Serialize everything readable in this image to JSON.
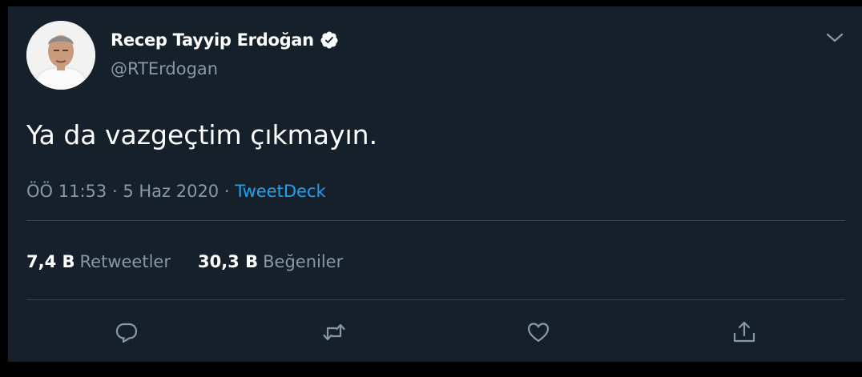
{
  "author": {
    "name": "Recep Tayyip Erdoğan",
    "handle": "@RTErdogan",
    "verified": true,
    "avatar_icon": "profile-photo"
  },
  "tweet": {
    "text": "Ya da vazgeçtim çıkmayın.",
    "time": "ÖÖ 11:53",
    "date": "5 Haz 2020",
    "separator": "·",
    "source": "TweetDeck"
  },
  "stats": {
    "retweets_count": "7,4 B",
    "retweets_label": "Retweetler",
    "likes_count": "30,3 B",
    "likes_label": "Beğeniler"
  },
  "actions": [
    "reply-icon",
    "retweet-icon",
    "like-icon",
    "share-icon"
  ],
  "colors": {
    "background": "#15202b",
    "text": "#ffffff",
    "muted": "#8899a6",
    "accent": "#1da1f2",
    "divider": "#38444d"
  }
}
